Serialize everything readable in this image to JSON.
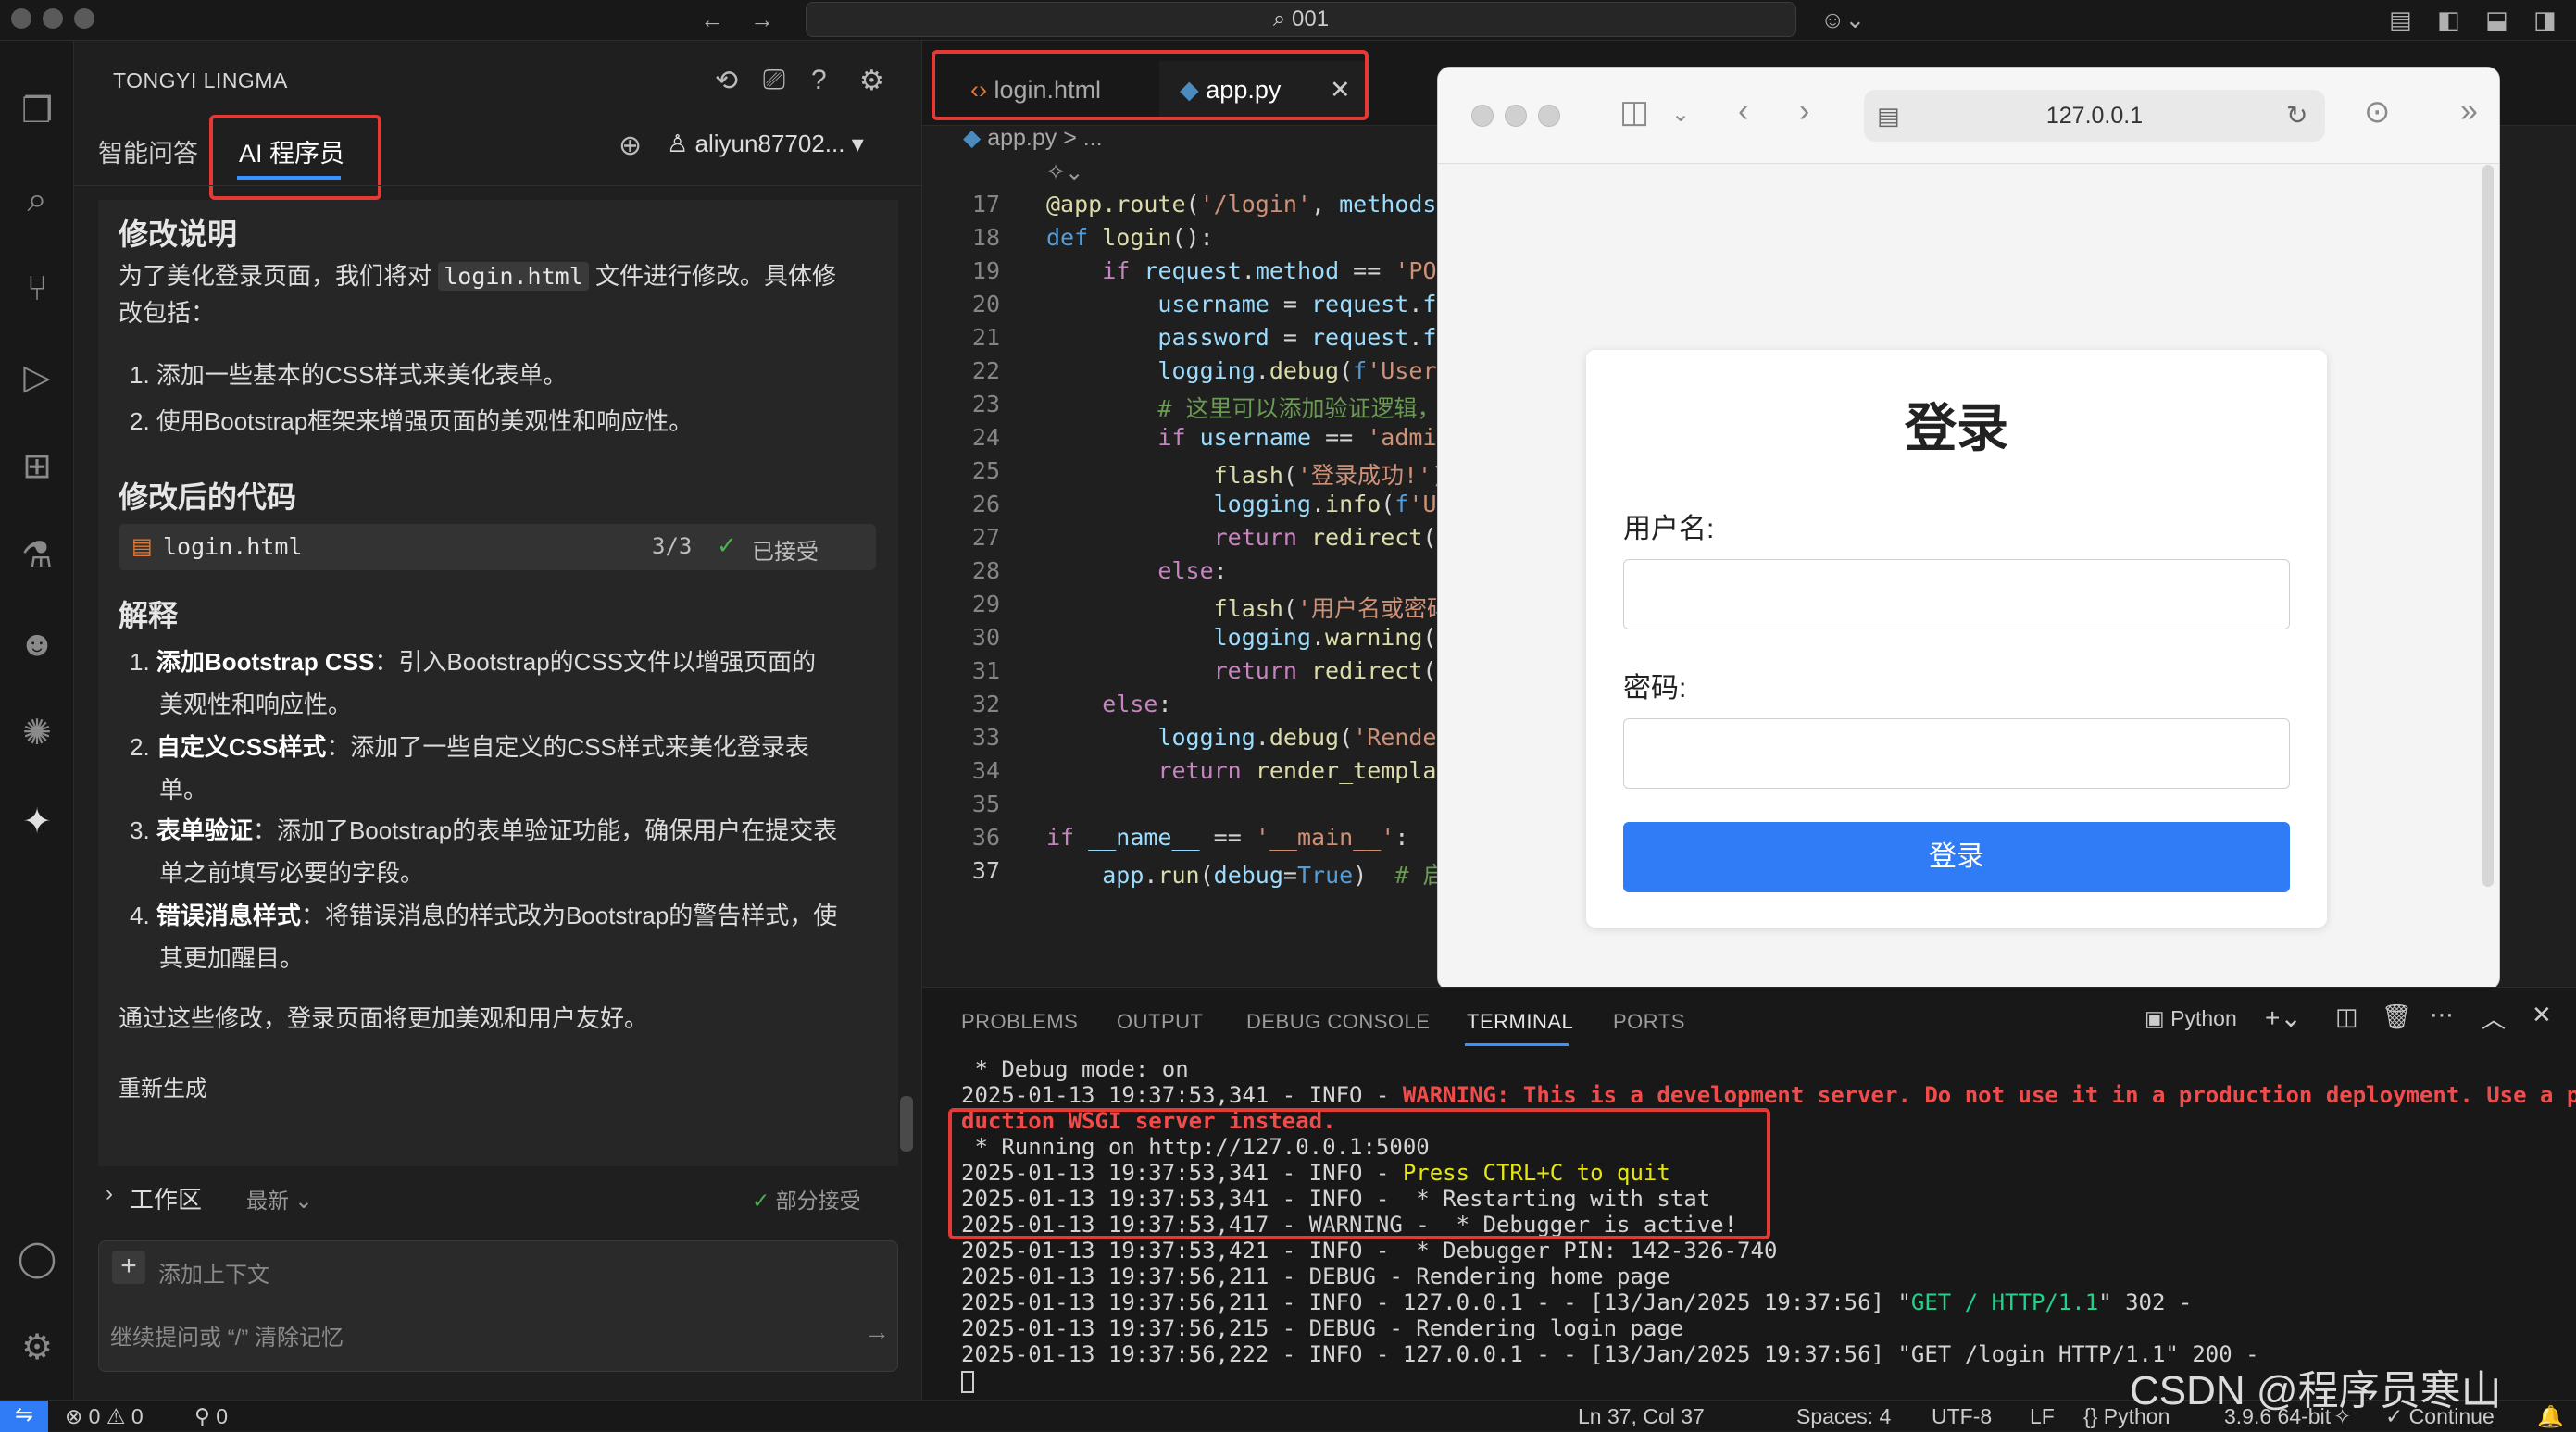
{
  "titlebar": {
    "search": "001"
  },
  "ai_panel": {
    "title": "TONGYI LINGMA",
    "tabs": [
      "智能问答",
      "AI 程序员"
    ],
    "user": "aliyun87702...",
    "section1_title": "修改说明",
    "intro_a": "为了美化登录页面，我们将对",
    "intro_file": "login.html",
    "intro_b": "文件进行修改。具体修",
    "intro_c": "改包括：",
    "changes": [
      "1. 添加一些基本的CSS样式来美化表单。",
      "2. 使用Bootstrap框架来增强页面的美观性和响应性。"
    ],
    "section2_title": "修改后的代码",
    "file_chip": {
      "name": "login.html",
      "count": "3/3",
      "status": "已接受"
    },
    "section3_title": "解释",
    "explain": [
      {
        "num": "1.",
        "bold": "添加Bootstrap CSS",
        "text": "：引入Bootstrap的CSS文件以增强页面的",
        "cont": "美观性和响应性。"
      },
      {
        "num": "2.",
        "bold": "自定义CSS样式",
        "text": "：添加了一些自定义的CSS样式来美化登录表",
        "cont": "单。"
      },
      {
        "num": "3.",
        "bold": "表单验证",
        "text": "：添加了Bootstrap的表单验证功能，确保用户在提交表",
        "cont": "单之前填写必要的字段。"
      },
      {
        "num": "4.",
        "bold": "错误消息样式",
        "text": "：将错误消息的样式改为Bootstrap的警告样式，使",
        "cont": "其更加醒目。"
      }
    ],
    "summary": "通过这些修改，登录页面将更加美观和用户友好。",
    "regen": "重新生成",
    "workspace": "工作区",
    "latest": "最新",
    "partial_accept": "部分接受",
    "add_context": "添加上下文",
    "input_placeholder": "继续提问或 “/” 清除记忆"
  },
  "editor": {
    "tabs": [
      "login.html",
      "app.py"
    ],
    "breadcrumb": "app.py > ...",
    "lines": [
      "17",
      "18",
      "19",
      "20",
      "21",
      "22",
      "23",
      "24",
      "25",
      "26",
      "27",
      "28",
      "29",
      "30",
      "31",
      "32",
      "33",
      "34",
      "35",
      "36",
      "37"
    ]
  },
  "browser": {
    "url": "127.0.0.1",
    "heading": "登录",
    "username_label": "用户名:",
    "password_label": "密码:",
    "button": "登录"
  },
  "panel": {
    "tabs": [
      "PROBLEMS",
      "OUTPUT",
      "DEBUG CONSOLE",
      "TERMINAL",
      "PORTS"
    ],
    "shell": "Python"
  },
  "terminal_lines": [
    " * Debug mode: on",
    "2025-01-13 19:37:53,341 - INFO - WARNING: This is a development server. Do not use it in a production deployment. Use a pro",
    "duction WSGI server instead.",
    " * Running on http://127.0.0.1:5000",
    "2025-01-13 19:37:53,341 - INFO - Press CTRL+C to quit",
    "2025-01-13 19:37:53,341 - INFO -  * Restarting with stat",
    "2025-01-13 19:37:53,417 - WARNING -  * Debugger is active!",
    "2025-01-13 19:37:53,421 - INFO -  * Debugger PIN: 142-326-740",
    "2025-01-13 19:37:56,211 - DEBUG - Rendering home page",
    "2025-01-13 19:37:56,211 - INFO - 127.0.0.1 - - [13/Jan/2025 19:37:56] \"GET / HTTP/1.1\" 302 -",
    "2025-01-13 19:37:56,215 - DEBUG - Rendering login page",
    "2025-01-13 19:37:56,222 - INFO - 127.0.0.1 - - [13/Jan/2025 19:37:56] \"GET /login HTTP/1.1\" 200 -"
  ],
  "statusbar": {
    "errors": "0",
    "warnings": "0",
    "ports": "0",
    "position": "Ln 37, Col 37",
    "spaces": "Spaces: 4",
    "encoding": "UTF-8",
    "eol": "LF",
    "language": "Python",
    "interpreter": "3.9.6 64-bit",
    "continue": "Continue"
  },
  "watermark": "CSDN @程序员寒山"
}
